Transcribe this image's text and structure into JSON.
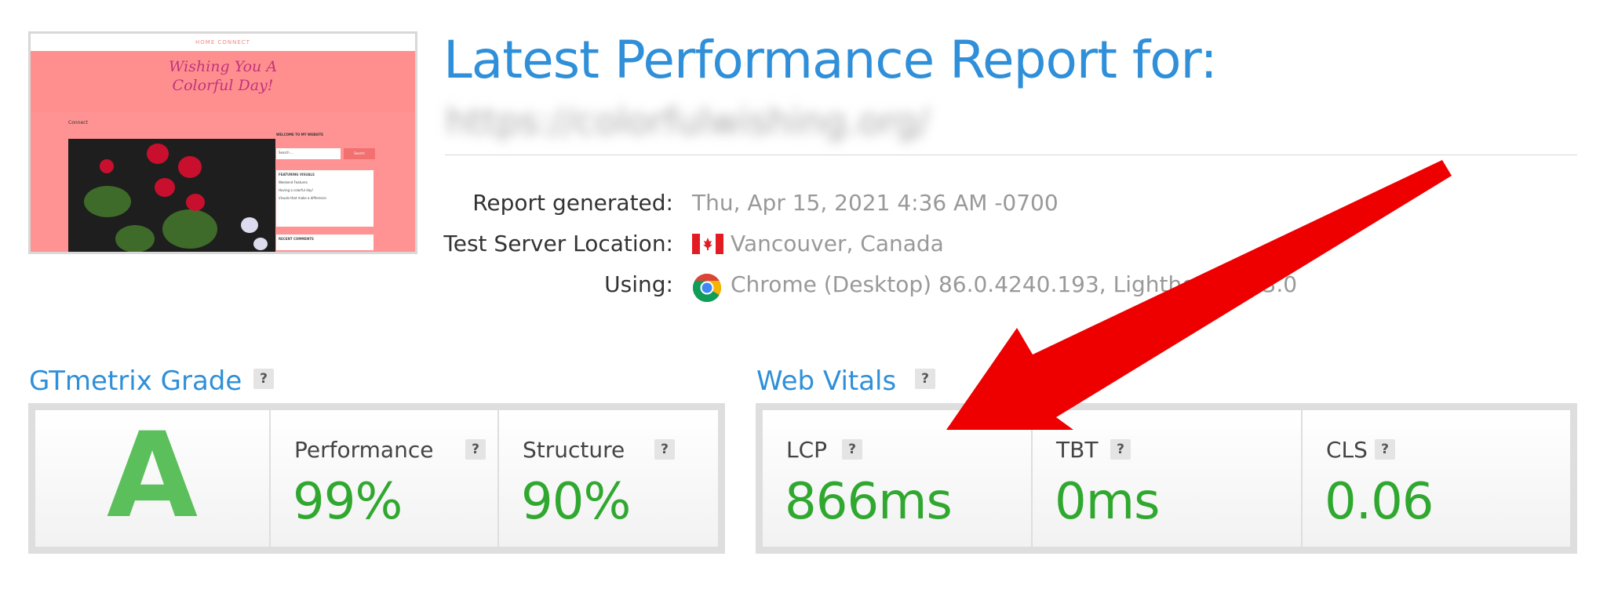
{
  "report": {
    "title": "Latest Performance Report for:",
    "url": "https://colorfulwishing.org/"
  },
  "info": [
    {
      "label": "Report generated:",
      "value": "Thu, Apr 15, 2021 4:36 AM -0700"
    },
    {
      "label": "Test Server Location:",
      "value": "Vancouver, Canada",
      "icon": "canada-flag-icon"
    },
    {
      "label": "Using:",
      "value": "Chrome (Desktop) 86.0.4240.193, Lighthouse 6.3.0",
      "icon": "chrome-icon"
    }
  ],
  "thumbnail": {
    "nav": "HOME   CONNECT",
    "hero_line1": "Wishing You A",
    "hero_line2": "Colorful Day!",
    "crumb": "Connect",
    "widget_title": "WELCOME TO MY WEBSITE",
    "search_placeholder": "Search ...",
    "search_button": "Search",
    "featured_title": "FEATURING VISUALS",
    "featured_items": [
      "Weekend Features",
      "Having a colorful day!",
      "Visuals that make a difference"
    ],
    "recent_title": "RECENT COMMENTS"
  },
  "grade": {
    "title": "GTmetrix Grade",
    "help": "?",
    "letter": "A",
    "metrics": [
      {
        "label": "Performance",
        "value": "99%"
      },
      {
        "label": "Structure",
        "value": "90%"
      }
    ]
  },
  "vitals": {
    "title": "Web Vitals",
    "help": "?",
    "metrics": [
      {
        "label": "LCP",
        "value": "866ms"
      },
      {
        "label": "TBT",
        "value": "0ms"
      },
      {
        "label": "CLS",
        "value": "0.06"
      }
    ]
  },
  "colors": {
    "title_blue": "#2f8fd9",
    "good_green": "#30a830",
    "arrow_red": "#ee0000",
    "thumb_pink": "#ff8f8f"
  }
}
